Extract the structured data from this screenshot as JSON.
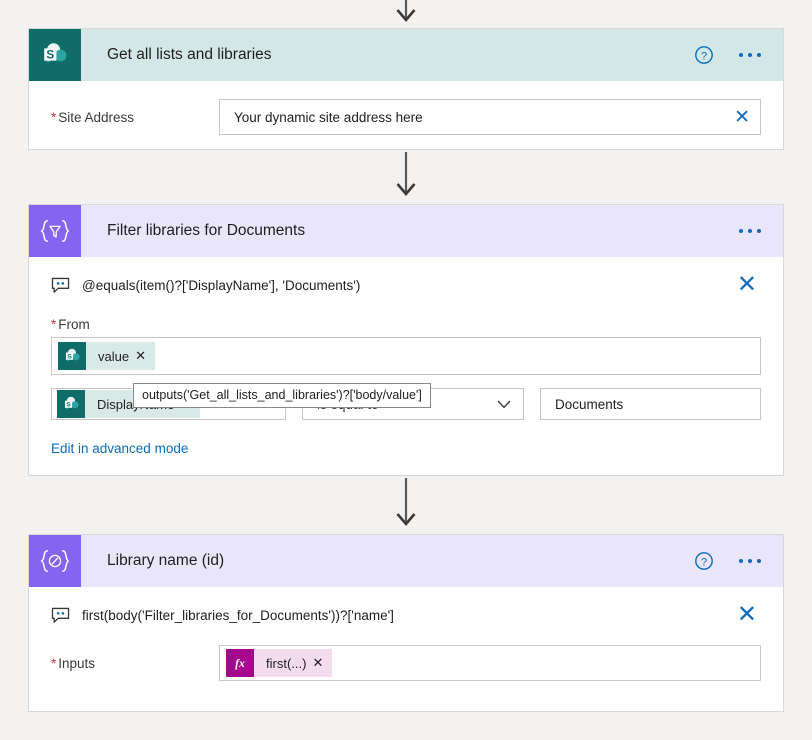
{
  "flow": {
    "cards": [
      {
        "id": "get-all-lists-and-libraries",
        "title": "Get all lists and libraries",
        "connector_icon": "sharepoint-icon",
        "header_theme": "teal",
        "has_help": true,
        "has_menu": true,
        "field_label": "Site Address",
        "field_required_marker": "*",
        "field_value": "Your dynamic site address here",
        "clear_icon": "close-icon"
      },
      {
        "id": "filter-libraries-for-documents",
        "title": "Filter libraries for Documents",
        "connector_icon": "filter-array-icon",
        "header_theme": "lilac",
        "has_help": false,
        "has_menu": true,
        "comment": "@equals(item()?['DisplayName'], 'Documents')",
        "comment_icon": "comment-icon",
        "close_icon": "close-icon",
        "from_label": "From",
        "from_required_marker": "*",
        "from_token": {
          "icon": "sharepoint-icon",
          "label": "value",
          "remove_icon": "close-icon"
        },
        "tooltip": "outputs('Get_all_lists_and_libraries')?['body/value']",
        "condition": {
          "left_token": {
            "icon": "sharepoint-icon",
            "label": "DisplayName",
            "remove_icon": "close-icon"
          },
          "operator": "is equal to",
          "operator_chevron": "chevron-down-icon",
          "right_value": "Documents"
        },
        "advanced_link": "Edit in advanced mode"
      },
      {
        "id": "library-name-id",
        "title": "Library name (id)",
        "connector_icon": "compose-icon",
        "header_theme": "lilac",
        "has_help": true,
        "has_menu": true,
        "comment": "first(body('Filter_libraries_for_Documents'))?['name']",
        "comment_icon": "comment-icon",
        "close_icon": "close-icon",
        "field_label": "Inputs",
        "field_required_marker": "*",
        "input_token": {
          "icon": "fx-icon",
          "label": "first(...)",
          "remove_icon": "close-icon"
        }
      }
    ],
    "connectors": [
      {
        "name": "arrow-top"
      },
      {
        "name": "arrow-card1-to-card2"
      },
      {
        "name": "arrow-card2-to-card3"
      }
    ],
    "help_icon": "help-circle-icon",
    "menu_icon": "ellipsis-icon"
  },
  "colors": {
    "sharepoint_teal": "#0f6c69",
    "header_teal": "#d3e8e6",
    "purple": "#8764f0",
    "header_lilac": "#e9e5fb",
    "link_blue": "#0f6cbd",
    "required_red": "#d13438",
    "fx_magenta": "#a4088c",
    "canvas_gray": "#f3f2f1"
  }
}
